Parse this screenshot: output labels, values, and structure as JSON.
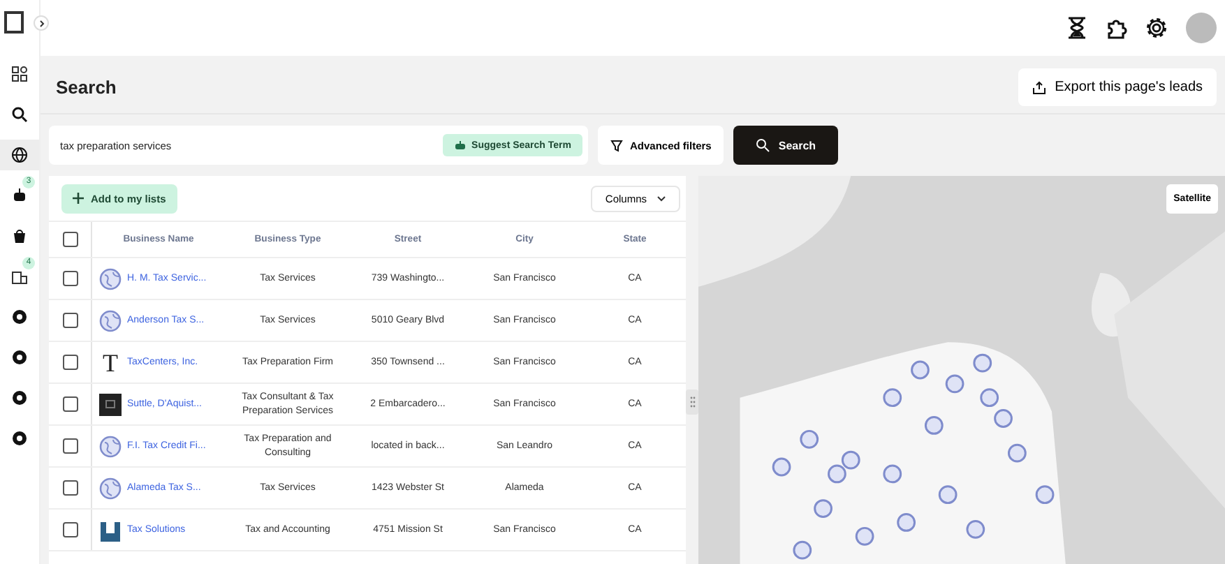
{
  "sidebar": {
    "items": [
      {
        "kind": "grid",
        "selected": false
      },
      {
        "kind": "search",
        "selected": false
      },
      {
        "kind": "globe",
        "selected": true
      },
      {
        "kind": "robot",
        "selected": false,
        "badge": "3"
      },
      {
        "kind": "bag",
        "selected": false
      },
      {
        "kind": "building",
        "selected": false,
        "badge": "4"
      },
      {
        "kind": "ring",
        "selected": false
      },
      {
        "kind": "ring",
        "selected": false
      },
      {
        "kind": "ring",
        "selected": false
      },
      {
        "kind": "ring",
        "selected": false
      }
    ]
  },
  "header": {
    "title": "Search",
    "export_button": "Export this page's leads"
  },
  "search": {
    "value": "tax preparation services",
    "suggest_button": "Suggest Search Term",
    "filters_button": "Advanced filters",
    "search_button": "Search"
  },
  "table": {
    "add_button": "Add to my lists",
    "columns_button": "Columns",
    "all_checked": false,
    "columns": [
      "Business Name",
      "Business Type",
      "Street",
      "City",
      "State"
    ],
    "rows": [
      {
        "checked": false,
        "kind": "globe",
        "name": "H. M. Tax Servic...",
        "type": "Tax Services",
        "street": "739 Washingto...",
        "city": "San Francisco",
        "state": "CA"
      },
      {
        "checked": false,
        "kind": "globe",
        "name": "Anderson Tax S...",
        "type": "Tax Services",
        "street": "5010 Geary Blvd",
        "city": "San Francisco",
        "state": "CA"
      },
      {
        "checked": false,
        "kind": "letter",
        "logo_text": "T",
        "name": "TaxCenters, Inc.",
        "type": "Tax Preparation Firm",
        "street": "350 Townsend ...",
        "city": "San Francisco",
        "state": "CA"
      },
      {
        "checked": false,
        "kind": "dark",
        "name": "Suttle, D'Aquist...",
        "type": "Tax Consultant & Tax Preparation Services",
        "street": "2 Embarcadero...",
        "city": "San Francisco",
        "state": "CA"
      },
      {
        "checked": false,
        "kind": "globe",
        "name": "F.I. Tax Credit Fi...",
        "type": "Tax Preparation and Consulting",
        "street": "located in back...",
        "city": "San Leandro",
        "state": "CA"
      },
      {
        "checked": false,
        "kind": "globe",
        "name": "Alameda Tax S...",
        "type": "Tax Services",
        "street": "1423 Webster St",
        "city": "Alameda",
        "state": "CA"
      },
      {
        "checked": false,
        "kind": "bars",
        "name": "Tax Solutions",
        "type": "Tax and Accounting",
        "street": "4751 Mission St",
        "city": "San Francisco",
        "state": "CA"
      }
    ]
  },
  "map": {
    "satellite_button": "Satellite"
  }
}
